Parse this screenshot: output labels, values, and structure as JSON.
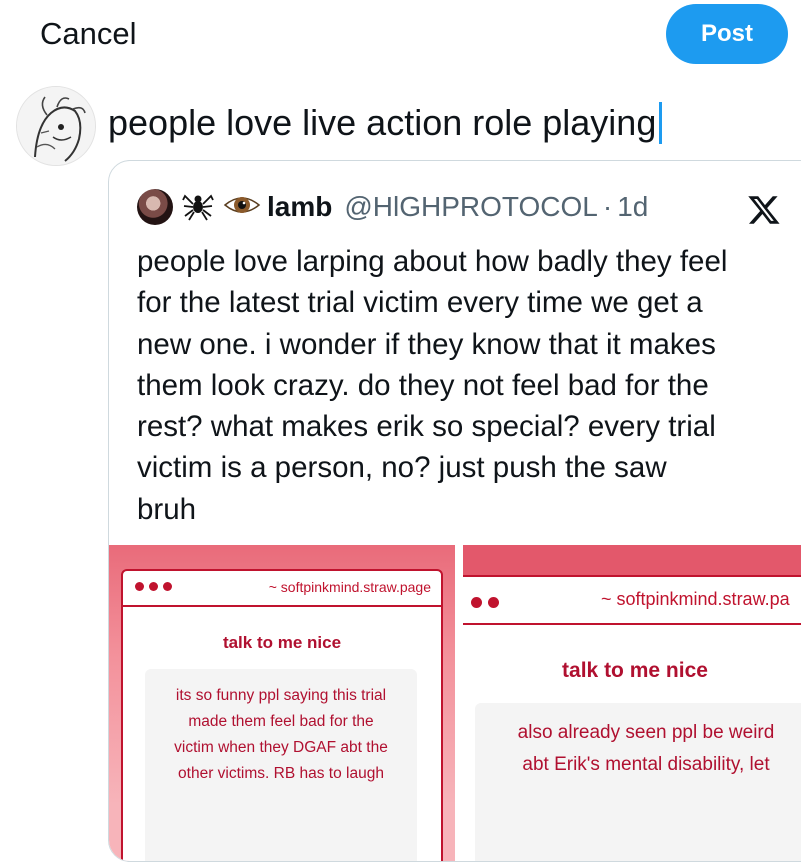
{
  "composer": {
    "cancel_label": "Cancel",
    "post_label": "Post",
    "draft_text": "people love live action role playing"
  },
  "quoted_post": {
    "emojis": [
      "🕷",
      "👁"
    ],
    "display_name": "lamb",
    "handle": "@HlGHPROTOCOL",
    "separator": "·",
    "time": "1d",
    "text_lines": [
      "people love larping about how badly they feel",
      "for the latest trial victim every time we get a",
      "new one. i wonder if they know that it makes",
      "them look crazy. do they not feel bad for the",
      "rest? what makes erik so special? every trial",
      "victim is a person, no? just push the saw",
      "bruh"
    ]
  },
  "images": {
    "left": {
      "url": "~ softpinkmind.straw.page",
      "title": "talk to me nice",
      "lines": [
        "its so funny ppl saying this trial",
        "made them feel bad for the",
        "victim when they DGAF abt the",
        "other victims. RB has to laugh"
      ]
    },
    "right": {
      "url": "~ softpinkmind.straw.pa",
      "title": "talk to me nice",
      "lines": [
        "also already seen ppl be weird",
        "abt Erik's mental disability, let"
      ]
    }
  },
  "colors": {
    "accent": "#1d9bf0",
    "card_red": "#c0132e"
  }
}
